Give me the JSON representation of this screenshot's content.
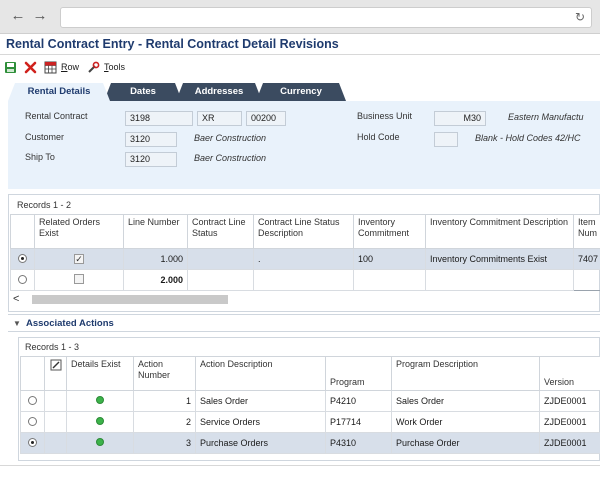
{
  "app": {
    "title": "Rental Contract Entry - Rental Contract Detail Revisions"
  },
  "toolbar": {
    "row_label": "Row",
    "tools_label": "Tools"
  },
  "tabs": [
    {
      "label": "Rental Details"
    },
    {
      "label": "Dates"
    },
    {
      "label": "Addresses"
    },
    {
      "label": "Currency"
    }
  ],
  "header": {
    "rental_contract_label": "Rental Contract",
    "rental_contract_number": "3198",
    "rental_contract_type": "XR",
    "rental_contract_company": "00200",
    "customer_label": "Customer",
    "customer_number": "3120",
    "customer_name": "Baer Construction",
    "ship_to_label": "Ship To",
    "ship_to_number": "3120",
    "ship_to_name": "Baer Construction",
    "business_unit_label": "Business Unit",
    "business_unit_value": "M30",
    "business_unit_desc": "Eastern Manufactu",
    "hold_code_label": "Hold Code",
    "hold_code_value": "",
    "hold_code_desc": "Blank - Hold Codes 42/HC"
  },
  "grid1": {
    "records_caption": "Records 1 - 2",
    "columns": [
      "",
      "Related Orders Exist",
      "Line Number",
      "Contract Line Status",
      "Contract Line Status Description",
      "Inventory Commitment",
      "Inventory Commitment Description",
      "Item Num"
    ],
    "rows": [
      {
        "related": "✓",
        "line": "1.000",
        "status": "",
        "status_desc": ".",
        "inv": "100",
        "inv_desc": "Inventory Commitments Exist",
        "item": "7407"
      },
      {
        "related": "",
        "line": "2.000",
        "status": "",
        "status_desc": "",
        "inv": "",
        "inv_desc": "",
        "item": ""
      }
    ]
  },
  "assoc": {
    "title": "Associated Actions",
    "records_caption": "Records 1 - 3",
    "columns": [
      "",
      "",
      "Details Exist",
      "Action Number",
      "Action Description",
      "Program",
      "Program Description",
      "Version"
    ],
    "rows": [
      {
        "action": "1",
        "action_desc": "Sales Order",
        "program": "P4210",
        "program_desc": "Sales Order",
        "version": "ZJDE0001"
      },
      {
        "action": "2",
        "action_desc": "Service Orders",
        "program": "P17714",
        "program_desc": "Work Order",
        "version": "ZJDE0001"
      },
      {
        "action": "3",
        "action_desc": "Purchase Orders",
        "program": "P4310",
        "program_desc": "Purchase Order",
        "version": "ZJDE0001"
      }
    ]
  },
  "colors": {
    "title_blue": "#1f3b6e",
    "tab_dark": "#3b4b60",
    "panel_blue": "#e9f2fb",
    "selected_row": "#d7dfea",
    "status_green": "#3cb34a"
  }
}
